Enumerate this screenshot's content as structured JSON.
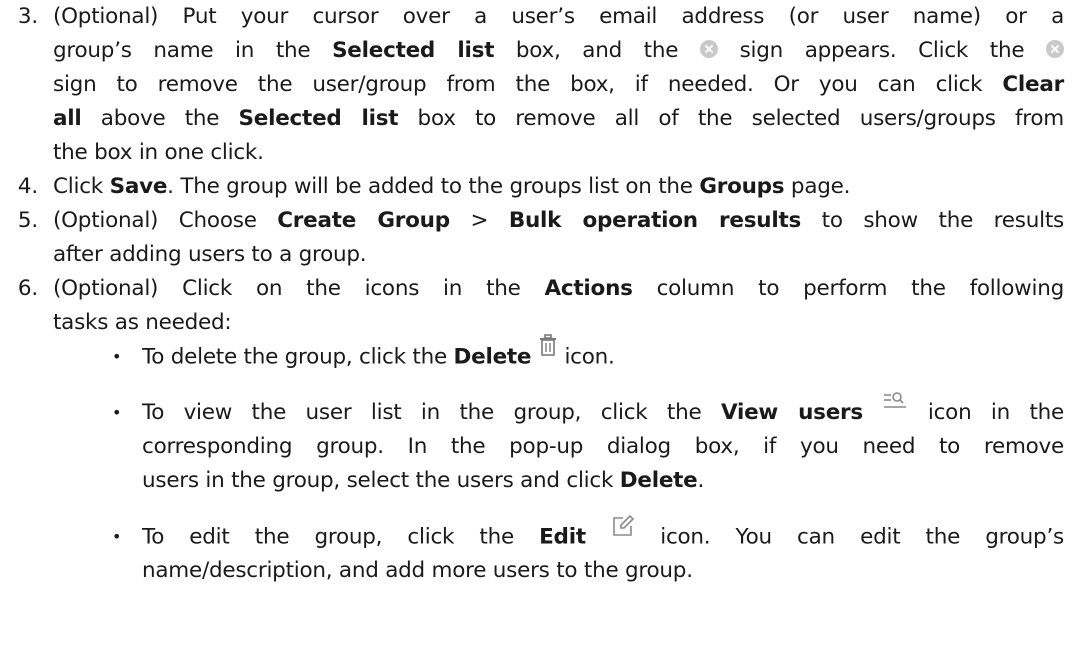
{
  "steps": [
    {
      "number": "3.",
      "lines": [
        [
          {
            "t": "(Optional) Put your cursor over a user’s email address (or user name) or a"
          }
        ],
        [
          {
            "t": "group’s name in the "
          },
          {
            "b": "Selected list"
          },
          {
            "t": " box, and the "
          },
          {
            "icon": "remove-circle-icon"
          },
          {
            "t": " sign appears. Click the "
          },
          {
            "icon": "remove-circle-icon"
          }
        ],
        [
          {
            "t": "sign to remove the user/group from the box, if needed. Or you can click "
          },
          {
            "b": "Clear"
          }
        ],
        [
          {
            "b": "all"
          },
          {
            "t": " above the "
          },
          {
            "b": "Selected list"
          },
          {
            "t": " box to remove all of the selected users/groups from"
          }
        ],
        [
          {
            "t": "the box in one click."
          }
        ]
      ]
    },
    {
      "number": "4.",
      "lines": [
        [
          {
            "t": "Click "
          },
          {
            "b": "Save"
          },
          {
            "t": ". The group will be added to the groups list on the "
          },
          {
            "b": "Groups"
          },
          {
            "t": " page."
          }
        ]
      ]
    },
    {
      "number": "5.",
      "lines": [
        [
          {
            "t": "(Optional) Choose "
          },
          {
            "b": "Create Group"
          },
          {
            "t": " > "
          },
          {
            "b": "Bulk operation results"
          },
          {
            "t": " to show the results"
          }
        ],
        [
          {
            "t": "after adding users to a group."
          }
        ]
      ]
    },
    {
      "number": "6.",
      "lines": [
        [
          {
            "t": "(Optional) Click on the icons in the "
          },
          {
            "b": "Actions"
          },
          {
            "t": " column to perform the following"
          }
        ],
        [
          {
            "t": "tasks as needed:"
          }
        ]
      ]
    }
  ],
  "bullets": [
    {
      "lines": [
        [
          {
            "t": "To delete the group, click the "
          },
          {
            "b": "Delete"
          },
          {
            "t": " "
          },
          {
            "icon": "trash-icon"
          },
          {
            "t": " icon."
          }
        ]
      ]
    },
    {
      "lines": [
        [
          {
            "t": "To view the user list in the group, click the "
          },
          {
            "b": "View users"
          },
          {
            "t": " "
          },
          {
            "icon": "view-users-icon"
          },
          {
            "t": " icon in the"
          }
        ],
        [
          {
            "t": "corresponding group. In the pop-up dialog box, if you need to remove"
          }
        ],
        [
          {
            "t": "users in the group, select the users and click "
          },
          {
            "b": "Delete"
          },
          {
            "t": "."
          }
        ]
      ]
    },
    {
      "lines": [
        [
          {
            "t": "To edit the group, click the "
          },
          {
            "b": "Edit"
          },
          {
            "t": " "
          },
          {
            "icon": "edit-icon"
          },
          {
            "t": " icon. You can edit the group’s"
          }
        ],
        [
          {
            "t": "name/description, and add more users to the group."
          }
        ]
      ]
    }
  ],
  "bullet_glyph": "•",
  "colors": {
    "text": "#1a1a1a",
    "icon_gray": "#c9c9c9"
  }
}
